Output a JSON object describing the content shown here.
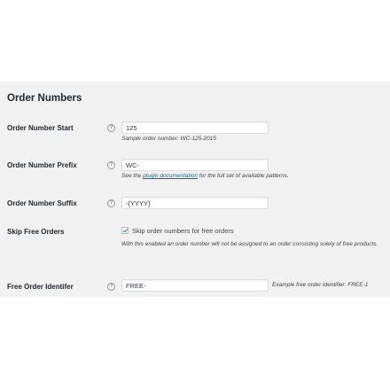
{
  "section": {
    "title": "Order Numbers"
  },
  "help_icon": "?",
  "rows": {
    "start": {
      "label": "Order Number Start",
      "value": "125",
      "description": "Sample order number: WC-125-2015"
    },
    "prefix": {
      "label": "Order Number Prefix",
      "value": "WC-",
      "description_before": "See the ",
      "description_link": "plugin documentation",
      "description_after": " for the full set of available patterns."
    },
    "suffix": {
      "label": "Order Number Suffix",
      "value": "-{YYYY}"
    },
    "skip_free": {
      "label": "Skip Free Orders",
      "checked": true,
      "checkbox_label": "Skip order numbers for free orders",
      "description": "With this enabled an order number will not be assigned to an order consisting solely of free products."
    },
    "free_identifier": {
      "label": "Free Order Identifer",
      "value": "FREE-",
      "description": "Example free order identifier: FREE-1"
    }
  },
  "colors": {
    "panel_background": "#f1f1f1",
    "link": "#0073aa",
    "checkmark": "#1e8cbe"
  }
}
